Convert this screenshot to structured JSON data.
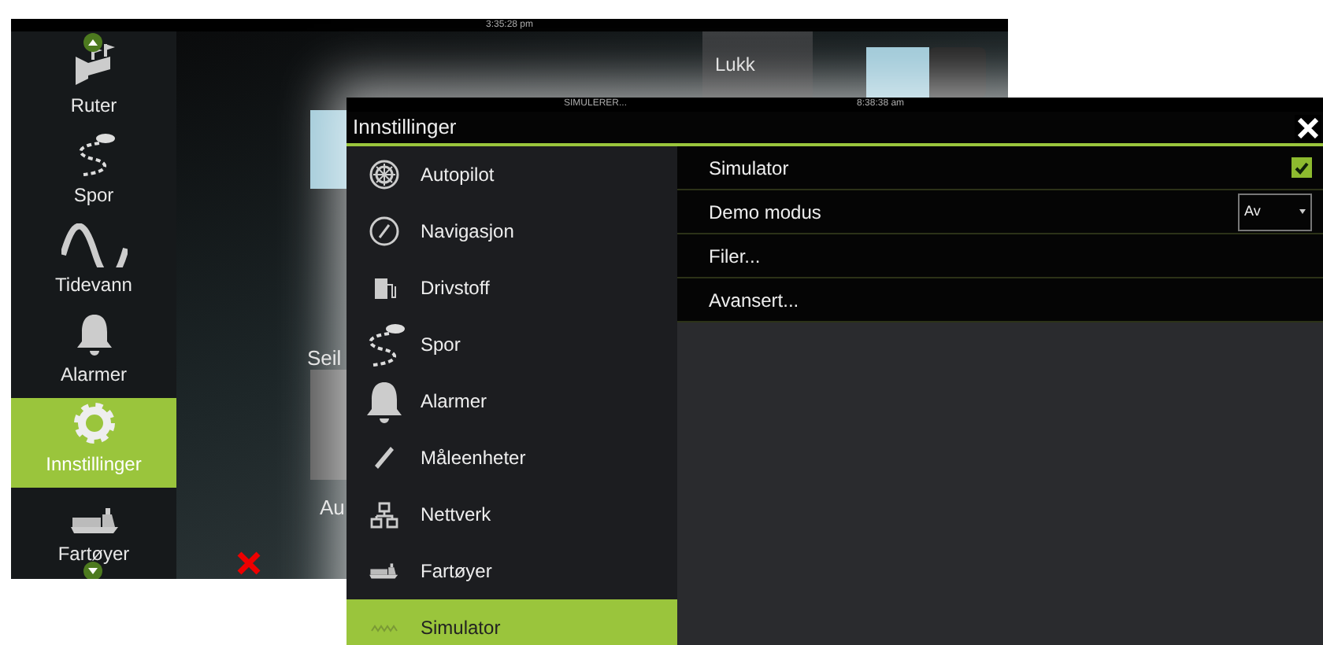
{
  "back_screen": {
    "time": "3:35:28 pm",
    "sidebar": [
      {
        "label": "Ruter",
        "kind": "route",
        "selected": false
      },
      {
        "label": "Spor",
        "kind": "track",
        "selected": false
      },
      {
        "label": "Tidevann",
        "kind": "tide",
        "selected": false
      },
      {
        "label": "Alarmer",
        "kind": "alarm",
        "selected": false
      },
      {
        "label": "Innstillinger",
        "kind": "settings",
        "selected": true
      },
      {
        "label": "Fartøyer",
        "kind": "vessel",
        "selected": false
      }
    ],
    "close_button": "Lukk",
    "tile_labels": [
      "Seil",
      "Au"
    ]
  },
  "dialog": {
    "status": "SIMULERER...",
    "time": "8:38:38 am",
    "title": "Innstillinger",
    "menu": [
      {
        "label": "Autopilot",
        "kind": "autopilot",
        "selected": false
      },
      {
        "label": "Navigasjon",
        "kind": "navigation",
        "selected": false
      },
      {
        "label": "Drivstoff",
        "kind": "fuel",
        "selected": false
      },
      {
        "label": "Spor",
        "kind": "track",
        "selected": false
      },
      {
        "label": "Alarmer",
        "kind": "alarm",
        "selected": false
      },
      {
        "label": "Måleenheter",
        "kind": "units",
        "selected": false
      },
      {
        "label": "Nettverk",
        "kind": "network",
        "selected": false
      },
      {
        "label": "Fartøyer",
        "kind": "vessel",
        "selected": false
      },
      {
        "label": "Simulator",
        "kind": "simulator",
        "selected": true
      }
    ],
    "settings": [
      {
        "kind": "checkbox",
        "label": "Simulator",
        "checked": true
      },
      {
        "kind": "dropdown",
        "label": "Demo modus",
        "value": "Av"
      },
      {
        "kind": "link",
        "label": "Filer..."
      },
      {
        "kind": "link",
        "label": "Avansert..."
      }
    ]
  }
}
